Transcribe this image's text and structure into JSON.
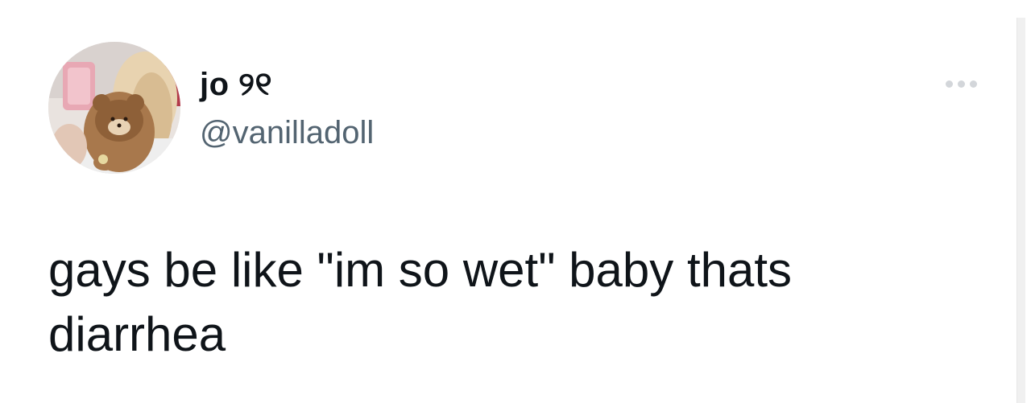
{
  "tweet": {
    "author": {
      "display_name": "jo ୨୧",
      "handle": "@vanilladoll",
      "avatar_icon": "profile-photo-icon"
    },
    "more_icon": "ellipsis-icon",
    "text": "gays be like \"im so wet\" baby thats diarrhea"
  },
  "colors": {
    "background": "#ffffff",
    "primary_text": "#0f1419",
    "secondary_text": "#536471",
    "more_dots": "#d3d6da"
  }
}
